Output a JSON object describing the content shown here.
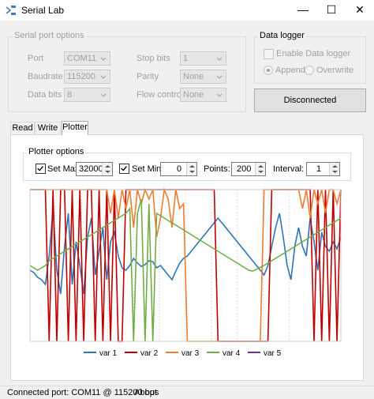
{
  "window": {
    "title": "Serial Lab",
    "minimize": "—",
    "maximize": "☐",
    "close": "✕"
  },
  "serial_options": {
    "legend": "Serial port options",
    "port_label": "Port",
    "port_value": "COM11",
    "baud_label": "Baudrate",
    "baud_value": "115200",
    "databits_label": "Data bits",
    "databits_value": "8",
    "stopbits_label": "Stop bits",
    "stopbits_value": "1",
    "parity_label": "Parity",
    "parity_value": "None",
    "flow_label": "Flow control",
    "flow_value": "None"
  },
  "logger": {
    "legend": "Data logger",
    "enable_label": "Enable Data logger",
    "append_label": "Append",
    "overwrite_label": "Overwrite"
  },
  "connect_button": "Disconnected",
  "tabs": [
    "Read",
    "Write",
    "Plotter"
  ],
  "plotter_options": {
    "legend": "Plotter options",
    "set_max_label": "Set Max:",
    "set_max_value": "32000",
    "set_min_label": "Set Min:",
    "set_min_value": "0",
    "points_label": "Points:",
    "points_value": "200",
    "interval_label": "Interval:",
    "interval_value": "1"
  },
  "chart_data": {
    "type": "line",
    "ylim": [
      0,
      32000
    ],
    "x_points": 200,
    "grid": true,
    "legend_position": "bottom",
    "series": [
      {
        "name": "var 1",
        "color": "#2e75b6",
        "values": [
          15000,
          14500,
          13500,
          13000,
          12000,
          18000,
          28000,
          15000,
          10000,
          20000,
          27000,
          12000,
          21000,
          16000,
          10000,
          22000,
          26000,
          14000,
          19000,
          24000,
          13000,
          21000,
          23000,
          18000,
          15500,
          15000,
          16000,
          17500,
          16500,
          15800,
          16200,
          17000,
          16800,
          15500,
          16000,
          15000,
          14000,
          13000,
          14800,
          16500,
          17500,
          18000,
          19000,
          20000,
          21000,
          22000,
          23000,
          24000,
          25000,
          26000,
          25000,
          24000,
          23000,
          22000,
          21000,
          20000,
          19000,
          18000,
          17000,
          16000,
          15000,
          14000,
          16000,
          20000,
          24000,
          27000,
          22000,
          16000,
          13000,
          20000,
          24000,
          20000,
          18000,
          26000,
          21000,
          15000,
          23000,
          20000,
          19000,
          21000,
          19500,
          22000
        ]
      },
      {
        "name": "var 2",
        "color": "#c00000",
        "values": [
          32000,
          32000,
          32000,
          32000,
          32000,
          0,
          32000,
          0,
          32000,
          32000,
          0,
          32000,
          0,
          32000,
          0,
          32000,
          32000,
          0,
          32000,
          0,
          32000,
          0,
          32000,
          0,
          0,
          32000,
          32000,
          32000,
          32000,
          32000,
          32000,
          32000,
          32000,
          32000,
          32000,
          32000,
          32000,
          32000,
          32000,
          32000,
          32000,
          32000,
          32000,
          32000,
          32000,
          32000,
          32000,
          32000,
          32000,
          0,
          0,
          0,
          0,
          0,
          0,
          0,
          0,
          0,
          0,
          0,
          0,
          0,
          0,
          32000,
          32000,
          32000,
          32000,
          32000,
          32000,
          32000,
          32000,
          32000,
          32000,
          32000,
          0,
          32000,
          0,
          32000,
          0,
          32000,
          0,
          32000
        ]
      },
      {
        "name": "var 3",
        "color": "#ed7d31",
        "values": [
          32000,
          32000,
          32000,
          32000,
          32000,
          32000,
          32000,
          32000,
          32000,
          32000,
          32000,
          32000,
          32000,
          32000,
          32000,
          32000,
          32000,
          32000,
          32000,
          32000,
          32000,
          27000,
          32000,
          26000,
          32000,
          28000,
          32000,
          24000,
          32000,
          29000,
          32000,
          30000,
          32000,
          22000,
          26000,
          32000,
          30000,
          24000,
          32000,
          28000,
          29000,
          0,
          0,
          0,
          0,
          0,
          0,
          0,
          0,
          0,
          0,
          0,
          0,
          0,
          0,
          0,
          0,
          0,
          0,
          0,
          0,
          32000,
          32000,
          32000,
          32000,
          32000,
          32000,
          32000,
          32000,
          32000,
          32000,
          28000,
          32000,
          26000,
          32000,
          29000,
          32000,
          27000,
          32000,
          32000,
          29000,
          32000
        ]
      },
      {
        "name": "var 4",
        "color": "#70ad47",
        "values": [
          16000,
          15500,
          15000,
          15500,
          16000,
          17000,
          17500,
          18000,
          18500,
          19000,
          19500,
          20000,
          20500,
          21000,
          21500,
          22000,
          22500,
          23000,
          23500,
          24000,
          24500,
          25000,
          25500,
          26000,
          26500,
          27000,
          28000,
          0,
          27000,
          30000,
          0,
          29000,
          0,
          27000,
          26500,
          26000,
          25500,
          25000,
          24500,
          24000,
          23500,
          23000,
          22500,
          22000,
          21500,
          21000,
          20500,
          20000,
          19500,
          19000,
          18500,
          18000,
          17500,
          17000,
          16500,
          16000,
          15500,
          15000,
          14800,
          15200,
          15600,
          16000,
          16500,
          17000,
          17500,
          18000,
          18500,
          19000,
          19500,
          20000,
          20500,
          21000,
          21500,
          22000,
          22500,
          23000,
          23500,
          24000,
          24500,
          25000,
          25500,
          26000
        ]
      },
      {
        "name": "var 5",
        "color": "#7030a0",
        "values": []
      }
    ]
  },
  "status": {
    "connected_port": "Connected port: COM11 @ 115200 bps",
    "about": "About"
  }
}
